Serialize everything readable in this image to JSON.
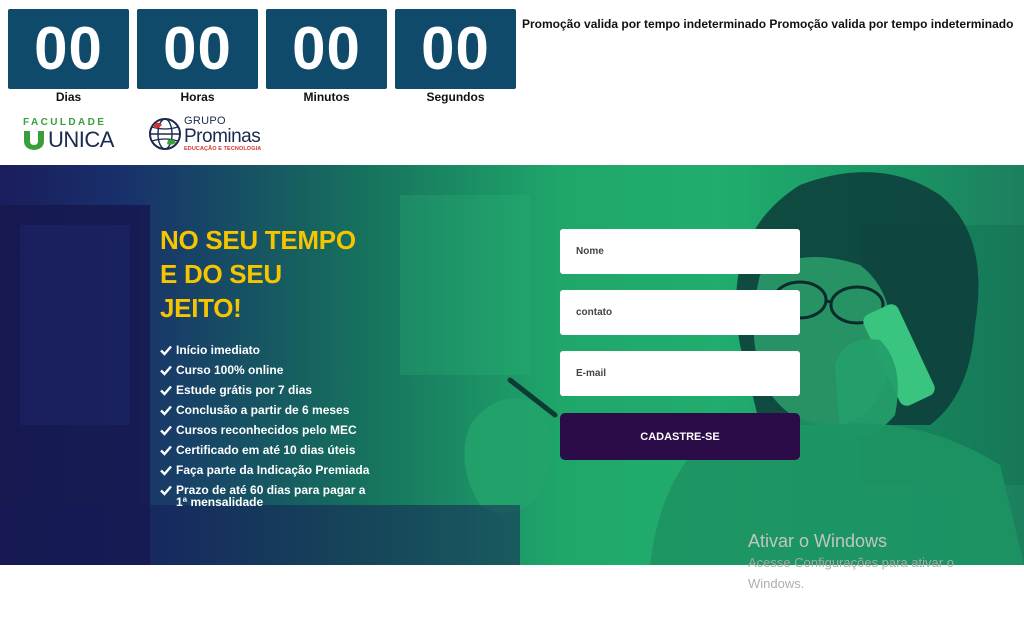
{
  "countdown": {
    "units": [
      {
        "value": "00",
        "label": "Dias"
      },
      {
        "value": "00",
        "label": "Horas"
      },
      {
        "value": "00",
        "label": "Minutos"
      },
      {
        "value": "00",
        "label": "Segundos"
      }
    ]
  },
  "promo_text": "Promoção valida por tempo indeterminado Promoção valida por tempo indeterminado",
  "logos": {
    "unica": {
      "top": "FACULDADE",
      "name": "UNICA"
    },
    "prominas": {
      "grupo": "GRUPO",
      "name": "Prominas",
      "sub": "EDUCAÇÃO E TECNOLOGIA"
    }
  },
  "hero": {
    "headline_lines": [
      "NO SEU TEMPO",
      "E DO SEU",
      "JEITO!"
    ],
    "features": [
      "Início imediato",
      "Curso 100% online",
      "Estude grátis por 7 dias",
      "Conclusão a partir de 6 meses",
      "Cursos reconhecidos pelo MEC",
      "Certificado em até 10 dias úteis",
      "Faça parte da Indicação Premiada",
      "Prazo de até 60 dias para pagar a 1ª mensalidade"
    ],
    "form": {
      "name_placeholder": "Nome",
      "contact_placeholder": "contato",
      "email_placeholder": "E-mail",
      "submit_label": "CADASTRE-SE"
    }
  },
  "watermark": {
    "title": "Ativar o Windows",
    "subtitle": "Acesse Configurações para ativar o Windows."
  },
  "colors": {
    "countdown_bg": "#0f4a6b",
    "headline": "#f7c400",
    "button_bg": "#2b0b48",
    "hero_green": "#1fa76a",
    "hero_navy": "#1b1d5e"
  }
}
